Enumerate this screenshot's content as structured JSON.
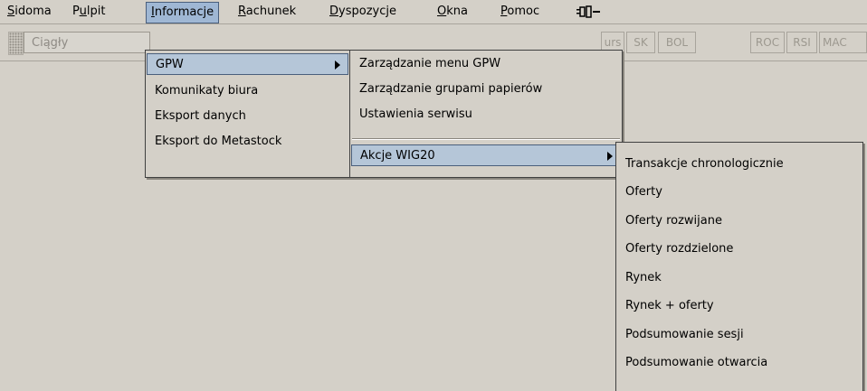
{
  "menubar": {
    "items": [
      {
        "pre": "",
        "key": "S",
        "post": "idoma"
      },
      {
        "pre": "P",
        "key": "u",
        "post": "lpit"
      },
      {
        "pre": "",
        "key": "I",
        "post": "nformacje"
      },
      {
        "pre": "",
        "key": "R",
        "post": "achunek"
      },
      {
        "pre": "",
        "key": "D",
        "post": "yspozycje"
      },
      {
        "pre": "",
        "key": "O",
        "post": "kna"
      },
      {
        "pre": "",
        "key": "P",
        "post": "omoc"
      }
    ]
  },
  "toolbar": {
    "mode_value": "Ciągły",
    "buttons": [
      "urs",
      "SK",
      "BOL",
      "ROC",
      "RSI",
      "MAC"
    ]
  },
  "menu_informacje": {
    "items": [
      "GPW",
      "Komunikaty biura",
      "Eksport danych",
      "Eksport do Metastock"
    ]
  },
  "menu_gpw": {
    "items": [
      "Zarządzanie menu GPW",
      "Zarządzanie grupami papierów",
      "Ustawienia serwisu",
      "Akcje WIG20"
    ]
  },
  "menu_akcje": {
    "items": [
      "Transakcje chronologicznie",
      "Oferty",
      "Oferty rozwijane",
      "Oferty rozdzielone",
      "Rynek",
      "Rynek + oferty",
      "Podsumowanie sesji",
      "Podsumowanie otwarcia"
    ]
  }
}
